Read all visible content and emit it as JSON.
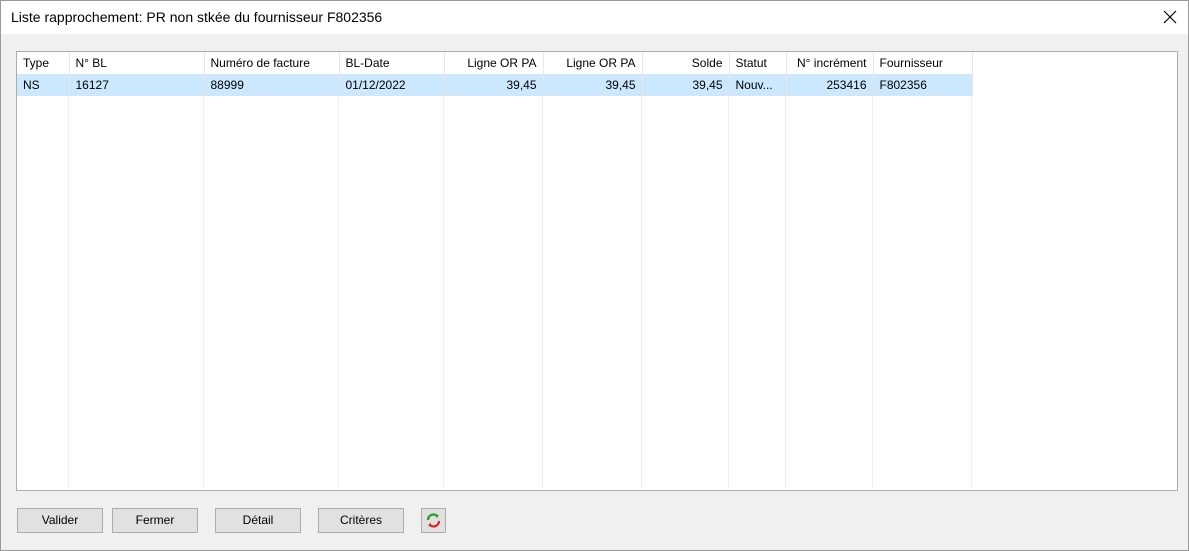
{
  "window": {
    "title": "Liste rapprochement: PR non stkée du fournisseur F802356"
  },
  "icons": {
    "close": "close-icon",
    "refresh": "refresh-icon"
  },
  "table": {
    "columns": [
      "Type",
      "N° BL",
      "Numéro de facture",
      "BL-Date",
      "Ligne OR PA",
      "Ligne OR PA",
      "Solde",
      "Statut",
      "N° incrément",
      "Fournisseur"
    ],
    "rows": [
      [
        "NS",
        "16127",
        "88999",
        "01/12/2022",
        "39,45",
        "39,45",
        "39,45",
        "Nouv...",
        "253416",
        "F802356"
      ]
    ]
  },
  "buttons": {
    "validate": "Valider",
    "close": "Fermer",
    "detail": "Détail",
    "criteria": "Critères"
  },
  "colors": {
    "selected_row": "#cce8ff",
    "button_bg": "#e1e1e1"
  }
}
